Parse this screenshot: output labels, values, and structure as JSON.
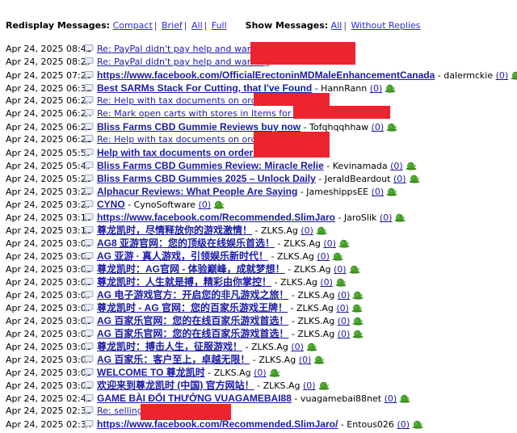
{
  "header": {
    "redisplay_label": "Redisplay Messages:",
    "redisplay_options": [
      "Compact",
      "Brief",
      "All",
      "Full"
    ],
    "show_label": "Show Messages:",
    "show_options": [
      "All",
      "Without Replies"
    ]
  },
  "colors": {
    "link": "#1a1aa6",
    "redaction": "#ee2330"
  },
  "messages": [
    {
      "date": "Apr 24, 2025 08:41",
      "title": "Re: PayPal didn't pay help and warning",
      "bold": false,
      "author": "",
      "count": "",
      "redacted": true
    },
    {
      "date": "Apr 24, 2025 08:27",
      "title": "Re: PayPal didn't pay help and warning",
      "bold": false,
      "author": "",
      "count": "",
      "redacted": true
    },
    {
      "date": "Apr 24, 2025 07:20",
      "title": "https://www.facebook.com/OfficialErectoninMDMaleEnhancementCanada",
      "bold": true,
      "author": "dalermckie",
      "count": "(0)",
      "redacted": false
    },
    {
      "date": "Apr 24, 2025 06:32",
      "title": "Best SARMs Stack For Cutting, that I've Found",
      "bold": true,
      "author": "HannRann",
      "count": "(0)",
      "redacted": false
    },
    {
      "date": "Apr 24, 2025 06:24",
      "title": "Re: Help with tax documents on orders",
      "bold": false,
      "author": "",
      "count": "",
      "redacted": true
    },
    {
      "date": "Apr 24, 2025 06:24",
      "title": "Re: Mark open carts with stores in Items for sale",
      "bold": false,
      "author": "",
      "count": "",
      "redacted": true
    },
    {
      "date": "Apr 24, 2025 06:22",
      "title": "Bliss Farms CBD Gummie Reviews buy now",
      "bold": true,
      "author": "Tofqhqqhhaw",
      "count": "(0)",
      "redacted": false
    },
    {
      "date": "Apr 24, 2025 06:21",
      "title": "Re: Help with tax documents on orders",
      "bold": false,
      "author": "",
      "count": "",
      "redacted": true
    },
    {
      "date": "Apr 24, 2025 05:57",
      "title": "Help with tax documents on orders",
      "bold": true,
      "author": "",
      "count": "",
      "redacted": true
    },
    {
      "date": "Apr 24, 2025 05:47",
      "title": "Bliss Farms CBD Gummies Review: Miracle Relie",
      "bold": true,
      "author": "Kevinamada",
      "count": "(0)",
      "redacted": false
    },
    {
      "date": "Apr 24, 2025 05:20",
      "title": "Bliss Farms CBD Gummies 2025 – Unlock Daily",
      "bold": true,
      "author": "JeraldBeardout",
      "count": "(0)",
      "redacted": false
    },
    {
      "date": "Apr 24, 2025 03:28",
      "title": "Alphacur Reviews: What People Are Saying",
      "bold": true,
      "author": "JameshippsEE",
      "count": "(0)",
      "redacted": false
    },
    {
      "date": "Apr 24, 2025 03:27",
      "title": "CYNO",
      "bold": true,
      "author": "CynoSoftware",
      "count": "(0)",
      "redacted": false
    },
    {
      "date": "Apr 24, 2025 03:16",
      "title": "https://www.facebook.com/Recommended.SlimJaro",
      "bold": true,
      "author": "JaroSlik",
      "count": "(0)",
      "redacted": false
    },
    {
      "date": "Apr 24, 2025 03:10",
      "title": "尊龙凯时，尽情释放你的游戏激情！",
      "bold": true,
      "author": "ZLKS.Ag",
      "count": "(0)",
      "redacted": false
    },
    {
      "date": "Apr 24, 2025 03:09",
      "title": "AG8 亚游官网：您的顶级在线娱乐首选！",
      "bold": true,
      "author": "ZLKS.Ag",
      "count": "(0)",
      "redacted": false
    },
    {
      "date": "Apr 24, 2025 03:09",
      "title": "AG 亚游 · 真人游戏，引领娱乐新时代！",
      "bold": true,
      "author": "ZLKS.Ag",
      "count": "(0)",
      "redacted": false
    },
    {
      "date": "Apr 24, 2025 03:08",
      "title": "尊龙凯时：AG官网 - 体验巅峰，成就梦想！",
      "bold": true,
      "author": "ZLKS.Ag",
      "count": "(0)",
      "redacted": false
    },
    {
      "date": "Apr 24, 2025 03:08",
      "title": "尊龙凯时：人生就是搏，精彩由你掌控！",
      "bold": true,
      "author": "ZLKS.Ag",
      "count": "(0)",
      "redacted": false
    },
    {
      "date": "Apr 24, 2025 03:07",
      "title": "AG 电子游戏官方：开启您的非凡游戏之旅！",
      "bold": true,
      "author": "ZLKS.Ag",
      "count": "(0)",
      "redacted": false
    },
    {
      "date": "Apr 24, 2025 03:07",
      "title": "尊龙凯时 - AG 官网：您的百家乐游戏王牌！",
      "bold": true,
      "author": "ZLKS.Ag",
      "count": "(0)",
      "redacted": false
    },
    {
      "date": "Apr 24, 2025 03:06",
      "title": "AG 百家乐官网：您的在线百家乐游戏首选！",
      "bold": true,
      "author": "ZLKS.Ag",
      "count": "(0)",
      "redacted": false
    },
    {
      "date": "Apr 24, 2025 03:06",
      "title": "AG 百家乐官网：您的在线百家乐游戏首选！",
      "bold": true,
      "author": "ZLKS.Ag",
      "count": "(0)",
      "redacted": false
    },
    {
      "date": "Apr 24, 2025 03:06",
      "title": "尊龙凯时：搏击人生，征服游戏！",
      "bold": true,
      "author": "ZLKS.Ag",
      "count": "(0)",
      "redacted": false
    },
    {
      "date": "Apr 24, 2025 03:04",
      "title": "AG 百家乐：客户至上，卓越无限！",
      "bold": true,
      "author": "ZLKS.Ag",
      "count": "(0)",
      "redacted": false
    },
    {
      "date": "Apr 24, 2025 03:03",
      "title": "WELCOME TO 尊龙凯时",
      "bold": true,
      "author": "ZLKS.Ag",
      "count": "(0)",
      "redacted": false
    },
    {
      "date": "Apr 24, 2025 03:02",
      "title": "欢迎来到尊龙凯时 (中国) 官方网站！",
      "bold": true,
      "author": "ZLKS.Ag",
      "count": "(0)",
      "redacted": false
    },
    {
      "date": "Apr 24, 2025 02:48",
      "title": "GAME BÀI ĐỔI THƯỞNG VUAGAMEBAI88",
      "bold": true,
      "author": "vuagamebai88net",
      "count": "(0)",
      "redacted": false
    },
    {
      "date": "Apr 24, 2025 02:38",
      "title": "Re: selling",
      "bold": false,
      "author": "",
      "count": "",
      "redacted": true
    },
    {
      "date": "Apr 24, 2025 02:34",
      "title": "https://www.facebook.com/Recommended.SlimJaro/",
      "bold": true,
      "author": "Entous026",
      "count": "(0)",
      "redacted": false
    }
  ]
}
